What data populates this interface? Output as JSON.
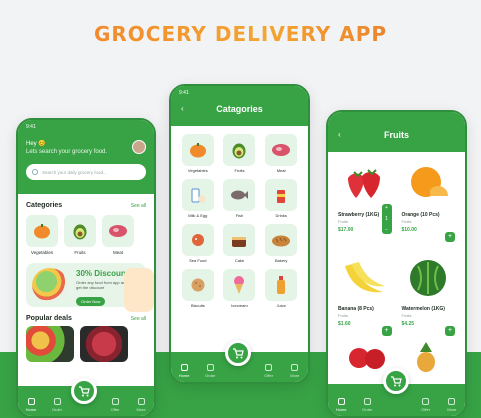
{
  "headline": "GROCERY DELIVERY APP",
  "status_time": "9:41",
  "home": {
    "greeting": "Hey 😊",
    "subtitle": "Lets search your grocery food.",
    "search_placeholder": "Search your daily grocery food...",
    "categories_title": "Categories",
    "see_all": "See all",
    "categories": [
      "Vegetables",
      "Fruits",
      "Meat"
    ],
    "discount_title": "30% Discount",
    "discount_text": "Order any food from app and get the discount",
    "discount_button": "Order Now",
    "deals_title": "Popular deals"
  },
  "categories_screen": {
    "title": "Catagories",
    "items": [
      "Vegetables",
      "Fruits",
      "Meat",
      "Milk & Egg",
      "Fish",
      "Drinks",
      "Sea Food",
      "Cake",
      "Bakery",
      "Biscuits",
      "Icecream",
      "Juice"
    ]
  },
  "fruits_screen": {
    "title": "Fruits",
    "products": [
      {
        "name": "Strawberry (1KG)",
        "category": "Fruits",
        "price": "$17.00"
      },
      {
        "name": "Orange (10 Pcs)",
        "category": "Fruits",
        "price": "$10.00"
      },
      {
        "name": "Banana (8 Pcs)",
        "category": "Fruits",
        "price": "$1.60"
      },
      {
        "name": "Watermelon (1KG)",
        "category": "Fruits",
        "price": "$4.25"
      }
    ]
  },
  "nav": [
    "Home",
    "Order",
    "Offer",
    "More"
  ],
  "colors": {
    "primary": "#37a345",
    "accent": "#f07b2a"
  }
}
